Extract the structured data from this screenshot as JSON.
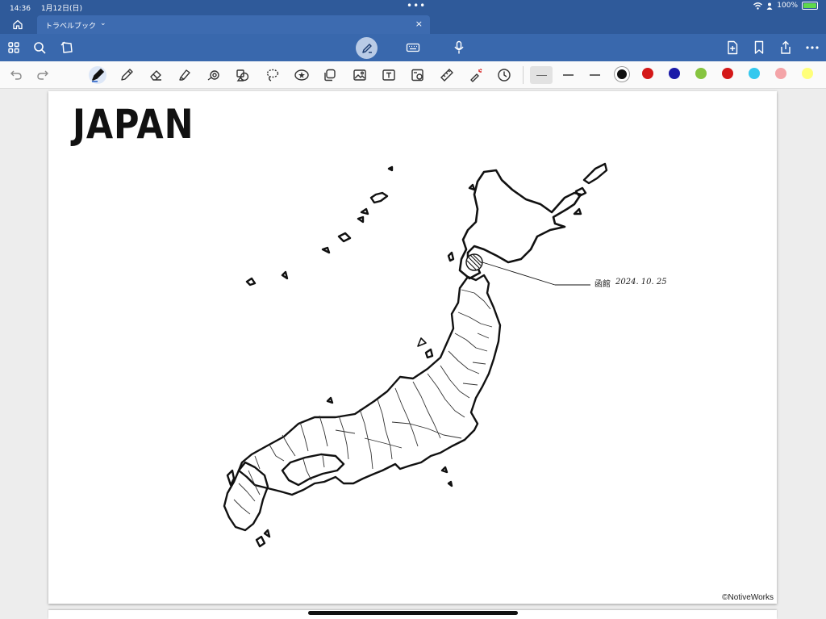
{
  "status_bar": {
    "time": "14:36",
    "date": "1月12日(日)",
    "multitask_dots": "•••",
    "battery_text": "100%",
    "battery_level": 1.0,
    "icons": [
      "wifi-icon",
      "person-icon",
      "battery-charging-icon"
    ]
  },
  "tabs": [
    {
      "label": "トラベルブック",
      "chevron": "⌄",
      "close": "×"
    }
  ],
  "toolbar": {
    "left_icons": [
      "grid-view-icon",
      "search-icon",
      "lasso-share-icon"
    ],
    "center_icons": [
      "pen-mode-icon",
      "keyboard-icon",
      "microphone-icon"
    ],
    "right_icons": [
      "add-page-icon",
      "bookmark-icon",
      "share-icon",
      "more-icon"
    ]
  },
  "tools": {
    "history": [
      "undo-icon",
      "redo-icon"
    ],
    "items": [
      "pen-icon",
      "pencil-icon",
      "eraser-icon",
      "highlighter-icon",
      "shape-icon",
      "element-icon",
      "lasso-icon",
      "sticker-icon",
      "copy-icon",
      "image-icon",
      "text-box-icon",
      "camera-icon",
      "ruler-icon",
      "laser-pointer-icon",
      "clock-icon"
    ],
    "active_tool": "pen-icon",
    "stroke_weights": [
      "thin",
      "medium",
      "thick"
    ],
    "selected_weight": "thin",
    "colors": [
      "#111111",
      "#d41818",
      "#1a1aa8",
      "#86c440",
      "#d41818",
      "#33c8ee",
      "#f4a4a8",
      "#ffff7a"
    ],
    "selected_color": "#111111"
  },
  "page": {
    "title": "JAPAN",
    "annotation_place": "函館",
    "annotation_date": "2024. 10. 25",
    "copyright": "©NotiveWorks"
  }
}
